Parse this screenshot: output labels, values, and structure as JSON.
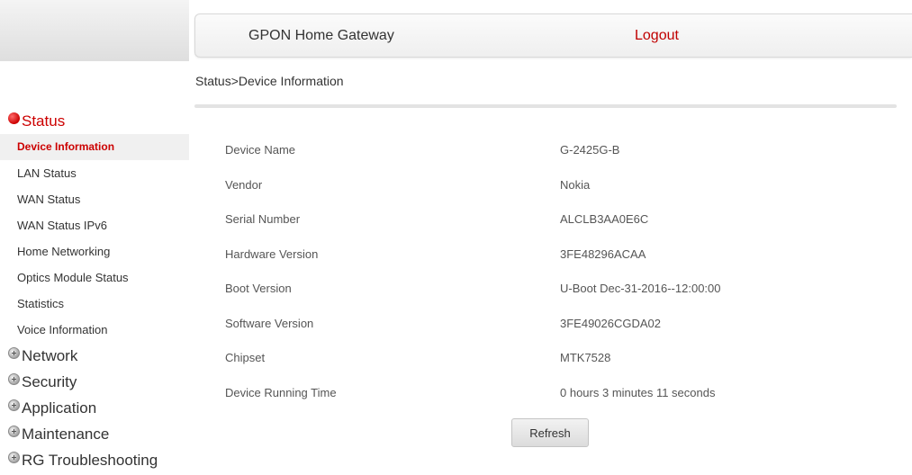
{
  "header": {
    "title": "GPON Home Gateway",
    "logout_label": "Logout"
  },
  "breadcrumb": "Status>Device Information",
  "sidebar": {
    "status": {
      "label": "Status",
      "icon": "collapse-bullet-icon",
      "items": [
        {
          "label": "Device Information",
          "active": true
        },
        {
          "label": "LAN Status"
        },
        {
          "label": "WAN Status"
        },
        {
          "label": "WAN Status IPv6"
        },
        {
          "label": "Home Networking"
        },
        {
          "label": "Optics Module Status"
        },
        {
          "label": "Statistics"
        },
        {
          "label": "Voice Information"
        }
      ]
    },
    "categories": [
      {
        "label": "Network",
        "icon": "expand-bullet-icon"
      },
      {
        "label": "Security",
        "icon": "expand-bullet-icon"
      },
      {
        "label": "Application",
        "icon": "expand-bullet-icon"
      },
      {
        "label": "Maintenance",
        "icon": "expand-bullet-icon"
      },
      {
        "label": "RG Troubleshooting",
        "icon": "expand-bullet-icon"
      }
    ]
  },
  "device_info": [
    {
      "label": "Device Name",
      "value": "G-2425G-B"
    },
    {
      "label": "Vendor",
      "value": "Nokia"
    },
    {
      "label": "Serial Number",
      "value": "ALCLB3AA0E6C"
    },
    {
      "label": "Hardware Version",
      "value": "3FE48296ACAA"
    },
    {
      "label": "Boot Version",
      "value": "U-Boot Dec-31-2016--12:00:00"
    },
    {
      "label": "Software Version",
      "value": "3FE49026CGDA02"
    },
    {
      "label": "Chipset",
      "value": "MTK7528"
    },
    {
      "label": "Device Running Time",
      "value": "0 hours 3 minutes 11 seconds"
    }
  ],
  "refresh_label": "Refresh",
  "colors": {
    "accent_red": "#cc0000",
    "logout_red": "#c00000",
    "text": "#333333"
  }
}
